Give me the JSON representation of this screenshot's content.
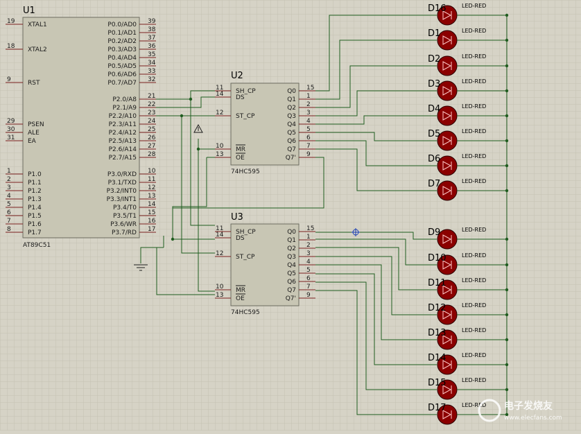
{
  "colors": {
    "background": "#d6d3c6",
    "grid": "#c4c1b2",
    "chip_fill": "#c8c6b4",
    "chip_border": "#6b6b5e",
    "wire": "#1f5c1f",
    "pin": "#7a1f1f",
    "led": "#8b0000"
  },
  "u1": {
    "ref": "U1",
    "part": "AT89C51",
    "left_pins": [
      {
        "num": "19",
        "name": "XTAL1"
      },
      {
        "num": "18",
        "name": "XTAL2"
      },
      {
        "num": "9",
        "name": "RST"
      },
      {
        "num": "29",
        "name": "PSEN"
      },
      {
        "num": "30",
        "name": "ALE"
      },
      {
        "num": "31",
        "name": "EA"
      },
      {
        "num": "1",
        "name": "P1.0"
      },
      {
        "num": "2",
        "name": "P1.1"
      },
      {
        "num": "3",
        "name": "P1.2"
      },
      {
        "num": "4",
        "name": "P1.3"
      },
      {
        "num": "5",
        "name": "P1.4"
      },
      {
        "num": "6",
        "name": "P1.5"
      },
      {
        "num": "7",
        "name": "P1.6"
      },
      {
        "num": "8",
        "name": "P1.7"
      }
    ],
    "right_pins": [
      {
        "num": "39",
        "name": "P0.0/AD0"
      },
      {
        "num": "38",
        "name": "P0.1/AD1"
      },
      {
        "num": "37",
        "name": "P0.2/AD2"
      },
      {
        "num": "36",
        "name": "P0.3/AD3"
      },
      {
        "num": "35",
        "name": "P0.4/AD4"
      },
      {
        "num": "34",
        "name": "P0.5/AD5"
      },
      {
        "num": "33",
        "name": "P0.6/AD6"
      },
      {
        "num": "32",
        "name": "P0.7/AD7"
      },
      {
        "num": "21",
        "name": "P2.0/A8"
      },
      {
        "num": "22",
        "name": "P2.1/A9"
      },
      {
        "num": "23",
        "name": "P2.2/A10"
      },
      {
        "num": "24",
        "name": "P2.3/A11"
      },
      {
        "num": "25",
        "name": "P2.4/A12"
      },
      {
        "num": "26",
        "name": "P2.5/A13"
      },
      {
        "num": "27",
        "name": "P2.6/A14"
      },
      {
        "num": "28",
        "name": "P2.7/A15"
      },
      {
        "num": "10",
        "name": "P3.0/RXD"
      },
      {
        "num": "11",
        "name": "P3.1/TXD"
      },
      {
        "num": "12",
        "name": "P3.2/INT0"
      },
      {
        "num": "13",
        "name": "P3.3/INT1"
      },
      {
        "num": "14",
        "name": "P3.4/T0"
      },
      {
        "num": "15",
        "name": "P3.5/T1"
      },
      {
        "num": "16",
        "name": "P3.6/WR"
      },
      {
        "num": "17",
        "name": "P3.7/RD"
      }
    ]
  },
  "shift_registers": [
    {
      "ref": "U2",
      "part": "74HC595",
      "left_pins": [
        {
          "num": "11",
          "name": "SH_CP"
        },
        {
          "num": "14",
          "name": "DS"
        },
        {
          "num": "12",
          "name": "ST_CP"
        },
        {
          "num": "10",
          "name": "MR"
        },
        {
          "num": "13",
          "name": "OE"
        }
      ],
      "right_pins": [
        {
          "num": "15",
          "name": "Q0"
        },
        {
          "num": "1",
          "name": "Q1"
        },
        {
          "num": "2",
          "name": "Q2"
        },
        {
          "num": "3",
          "name": "Q3"
        },
        {
          "num": "4",
          "name": "Q4"
        },
        {
          "num": "5",
          "name": "Q5"
        },
        {
          "num": "6",
          "name": "Q6"
        },
        {
          "num": "7",
          "name": "Q7"
        },
        {
          "num": "9",
          "name": "Q7'"
        }
      ]
    },
    {
      "ref": "U3",
      "part": "74HC595",
      "left_pins": [
        {
          "num": "11",
          "name": "SH_CP"
        },
        {
          "num": "14",
          "name": "DS"
        },
        {
          "num": "12",
          "name": "ST_CP"
        },
        {
          "num": "10",
          "name": "MR"
        },
        {
          "num": "13",
          "name": "OE"
        }
      ],
      "right_pins": [
        {
          "num": "15",
          "name": "Q0"
        },
        {
          "num": "1",
          "name": "Q1"
        },
        {
          "num": "2",
          "name": "Q2"
        },
        {
          "num": "3",
          "name": "Q3"
        },
        {
          "num": "4",
          "name": "Q4"
        },
        {
          "num": "5",
          "name": "Q5"
        },
        {
          "num": "6",
          "name": "Q6"
        },
        {
          "num": "7",
          "name": "Q7"
        },
        {
          "num": "9",
          "name": "Q7'"
        }
      ]
    }
  ],
  "leds": [
    {
      "ref": "D16",
      "label": "LED-RED"
    },
    {
      "ref": "D1",
      "label": "LED-RED"
    },
    {
      "ref": "D2",
      "label": "LED-RED"
    },
    {
      "ref": "D3",
      "label": "LED-RED"
    },
    {
      "ref": "D4",
      "label": "LED-RED"
    },
    {
      "ref": "D5",
      "label": "LED-RED"
    },
    {
      "ref": "D6",
      "label": "LED-RED"
    },
    {
      "ref": "D7",
      "label": "LED-RED"
    },
    {
      "ref": "D9",
      "label": "LED-RED"
    },
    {
      "ref": "D10",
      "label": "LED-RED"
    },
    {
      "ref": "D11",
      "label": "LED-RED"
    },
    {
      "ref": "D12",
      "label": "LED-RED"
    },
    {
      "ref": "D13",
      "label": "LED-RED"
    },
    {
      "ref": "D14",
      "label": "LED-RED"
    },
    {
      "ref": "D15",
      "label": "LED-RED"
    },
    {
      "ref": "D17",
      "label": "LED-RED"
    }
  ],
  "watermark": {
    "text": "电子发烧友",
    "url": "www.elecfans.com"
  }
}
